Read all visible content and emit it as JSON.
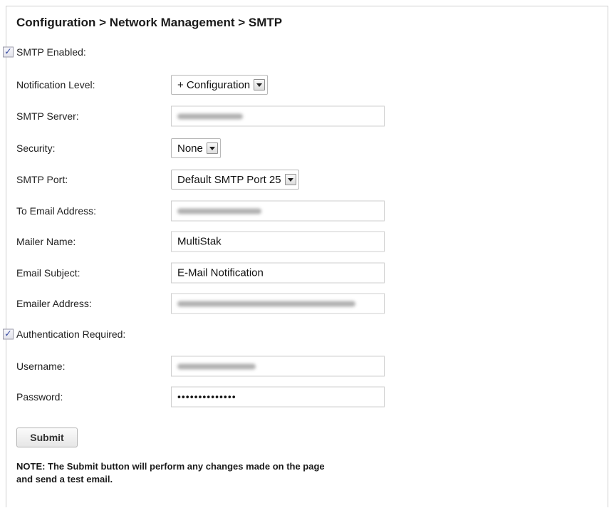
{
  "breadcrumb": "Configuration > Network Management > SMTP",
  "fields": {
    "smtp_enabled": {
      "label": "SMTP Enabled:",
      "checked": true
    },
    "notification_level": {
      "label": "Notification Level:",
      "value": "+ Configuration"
    },
    "smtp_server": {
      "label": "SMTP Server:",
      "value": ""
    },
    "security": {
      "label": "Security:",
      "value": "None"
    },
    "smtp_port": {
      "label": "SMTP Port:",
      "value": "Default SMTP Port 25"
    },
    "to_email": {
      "label": "To Email Address:",
      "value": ""
    },
    "mailer_name": {
      "label": "Mailer Name:",
      "value": "MultiStak"
    },
    "email_subject": {
      "label": "Email Subject:",
      "value": "E-Mail Notification"
    },
    "emailer_address": {
      "label": "Emailer Address:",
      "value": ""
    },
    "auth_required": {
      "label": "Authentication Required:",
      "checked": true
    },
    "username": {
      "label": "Username:",
      "value": ""
    },
    "password": {
      "label": "Password:",
      "value": "••••••••••••••"
    }
  },
  "submit_label": "Submit",
  "note": "NOTE: The Submit button will perform any changes made on the page and send a test email.",
  "colors": {
    "checkmark": "#3b4fa3",
    "border": "#cfcfcf"
  }
}
